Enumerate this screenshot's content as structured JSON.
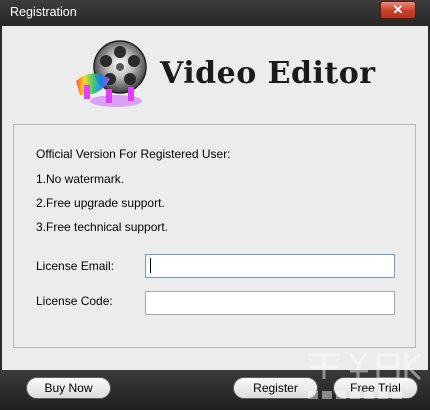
{
  "window": {
    "title": "Registration",
    "close_label": "✕"
  },
  "header": {
    "app_name": "Video Editor"
  },
  "info": {
    "heading": "Official Version For Registered User:",
    "benefits": [
      "1.No watermark.",
      "2.Free upgrade support.",
      "3.Free technical support."
    ]
  },
  "form": {
    "email_label": "License Email:",
    "email_value": "",
    "code_label": "License Code:",
    "code_value": ""
  },
  "buttons": {
    "buy": "Buy Now",
    "register": "Register",
    "trial": "Free Trial"
  }
}
